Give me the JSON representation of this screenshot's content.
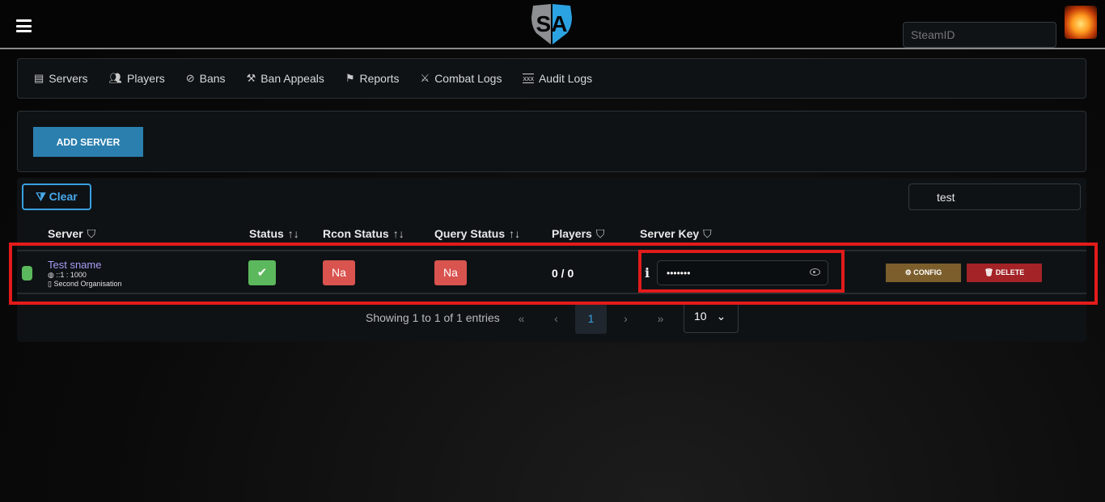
{
  "header": {
    "logo_text": "SA",
    "steamid_placeholder": "SteamID"
  },
  "nav": [
    {
      "label": "Servers",
      "icon": "server-icon"
    },
    {
      "label": "Players",
      "icon": "users-icon"
    },
    {
      "label": "Bans",
      "icon": "user-slash-icon"
    },
    {
      "label": "Ban Appeals",
      "icon": "gavel-icon"
    },
    {
      "label": "Reports",
      "icon": "flag-icon"
    },
    {
      "label": "Combat Logs",
      "icon": "fighters-icon"
    },
    {
      "label": "Audit Logs",
      "icon": "xxx-log-icon"
    }
  ],
  "add_server_label": "ADD SERVER",
  "table": {
    "clear_label": "Clear",
    "search_value": "test",
    "columns": [
      "Server",
      "Status",
      "Rcon Status",
      "Query Status",
      "Players",
      "Server Key"
    ],
    "rows": [
      {
        "name": "Test sname",
        "address": "::1 : 1000",
        "organisation": "Second Organisation",
        "status": "ok",
        "status_color": "#5cb85c",
        "rcon": "Na",
        "query": "Na",
        "players": "0 / 0",
        "server_key": "•••••••",
        "config_label": "CONFIG",
        "delete_label": "DELETE"
      }
    ],
    "footer": {
      "showing": "Showing 1 to 1 of 1 entries",
      "first": "«",
      "prev": "‹",
      "page": "1",
      "next": "›",
      "last": "»",
      "page_size": "10"
    }
  },
  "colors": {
    "accent": "#2a7fae",
    "ok": "#5cb85c",
    "na": "#d9534f",
    "config": "#7c5e2c",
    "delete": "#a32326",
    "highlight": "#e21b1b"
  }
}
